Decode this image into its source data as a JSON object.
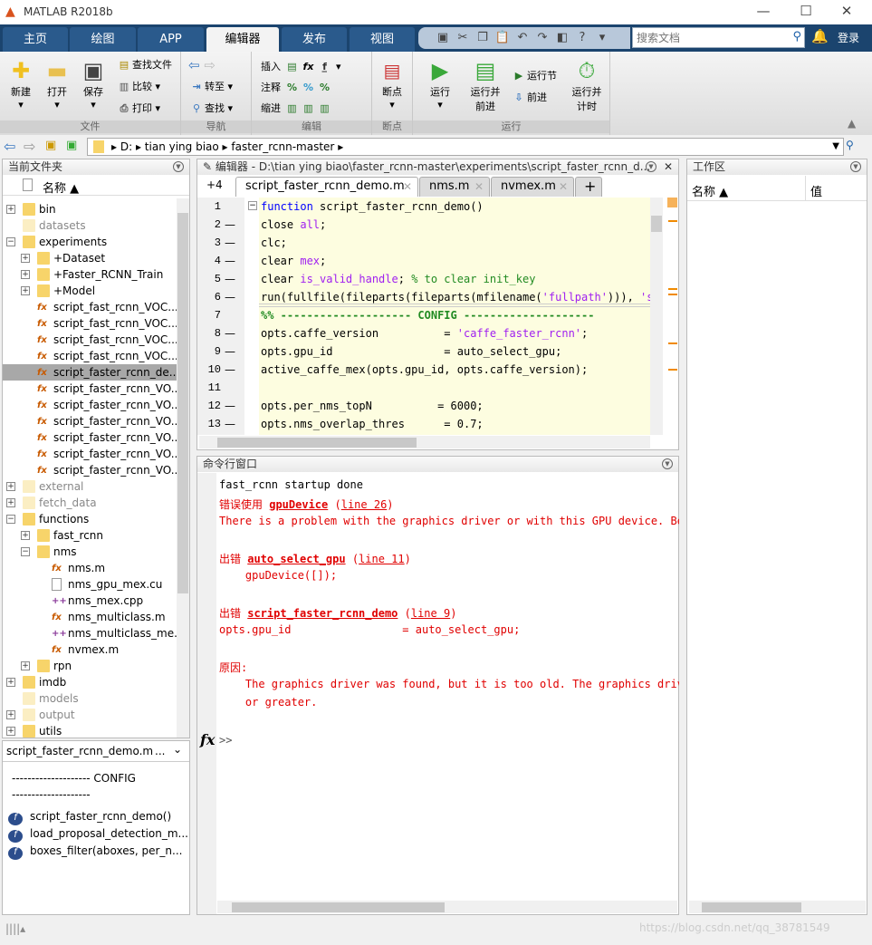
{
  "window": {
    "title": "MATLAB R2018b",
    "minimize": "—",
    "maximize": "☐",
    "close": "✕"
  },
  "tabs": [
    {
      "label": "主页"
    },
    {
      "label": "绘图"
    },
    {
      "label": "APP"
    },
    {
      "label": "编辑器",
      "active": true
    },
    {
      "label": "发布"
    },
    {
      "label": "视图"
    }
  ],
  "quick_access": [
    "save-icon",
    "cut-icon",
    "copy-icon",
    "paste-icon",
    "undo-icon",
    "redo-icon",
    "switch-windows-icon",
    "help-icon",
    "dropdown-icon"
  ],
  "search": {
    "placeholder": "搜索文档"
  },
  "login": "登录",
  "toolstrip": {
    "file": {
      "label": "文件",
      "new": "新建",
      "open": "打开",
      "save": "保存",
      "find_files": "查找文件",
      "compare": "比较",
      "print": "打印"
    },
    "navigate": {
      "label": "导航",
      "goto": "转至",
      "find": "查找"
    },
    "edit": {
      "label": "编辑",
      "insert": "插入",
      "comment": "注释",
      "indent": "缩进"
    },
    "breakpoints": {
      "label": "断点",
      "breakpoints": "断点"
    },
    "run": {
      "label": "运行",
      "run": "运行",
      "run_advance": "运行并\n前进",
      "run_section": "运行节",
      "advance": "前进",
      "run_time": "运行并\n计时"
    }
  },
  "address": {
    "path": [
      "D:",
      "tian ying biao",
      "faster_rcnn-master"
    ]
  },
  "current_folder": {
    "title": "当前文件夹",
    "col_name": "名称 ▲",
    "items": [
      {
        "name": "bin",
        "type": "folder",
        "level": 0,
        "expand": "+"
      },
      {
        "name": "datasets",
        "type": "folder",
        "level": 0,
        "dim": true
      },
      {
        "name": "experiments",
        "type": "folder",
        "level": 0,
        "expand": "-"
      },
      {
        "name": "+Dataset",
        "type": "folder",
        "level": 1,
        "expand": "+"
      },
      {
        "name": "+Faster_RCNN_Train",
        "type": "folder",
        "level": 1,
        "expand": "+"
      },
      {
        "name": "+Model",
        "type": "folder",
        "level": 1,
        "expand": "+"
      },
      {
        "name": "script_fast_rcnn_VOC...",
        "type": "m",
        "level": 1
      },
      {
        "name": "script_fast_rcnn_VOC...",
        "type": "m",
        "level": 1
      },
      {
        "name": "script_fast_rcnn_VOC...",
        "type": "m",
        "level": 1
      },
      {
        "name": "script_fast_rcnn_VOC...",
        "type": "m",
        "level": 1
      },
      {
        "name": "script_faster_rcnn_de...",
        "type": "m",
        "level": 1,
        "selected": true
      },
      {
        "name": "script_faster_rcnn_VO...",
        "type": "m",
        "level": 1
      },
      {
        "name": "script_faster_rcnn_VO...",
        "type": "m",
        "level": 1
      },
      {
        "name": "script_faster_rcnn_VO...",
        "type": "m",
        "level": 1
      },
      {
        "name": "script_faster_rcnn_VO...",
        "type": "m",
        "level": 1
      },
      {
        "name": "script_faster_rcnn_VO...",
        "type": "m",
        "level": 1
      },
      {
        "name": "script_faster_rcnn_VO...",
        "type": "m",
        "level": 1
      },
      {
        "name": "external",
        "type": "folder",
        "level": 0,
        "expand": "+",
        "dim": true
      },
      {
        "name": "fetch_data",
        "type": "folder",
        "level": 0,
        "expand": "+",
        "dim": true
      },
      {
        "name": "functions",
        "type": "folder",
        "level": 0,
        "expand": "-"
      },
      {
        "name": "fast_rcnn",
        "type": "folder",
        "level": 1,
        "expand": "+"
      },
      {
        "name": "nms",
        "type": "folder",
        "level": 1,
        "expand": "-"
      },
      {
        "name": "nms.m",
        "type": "m",
        "level": 2
      },
      {
        "name": "nms_gpu_mex.cu",
        "type": "file",
        "level": 2
      },
      {
        "name": "nms_mex.cpp",
        "type": "cpp",
        "level": 2
      },
      {
        "name": "nms_multiclass.m",
        "type": "m",
        "level": 2
      },
      {
        "name": "nms_multiclass_me...",
        "type": "cpp",
        "level": 2
      },
      {
        "name": "nvmex.m",
        "type": "m",
        "level": 2
      },
      {
        "name": "rpn",
        "type": "folder",
        "level": 1,
        "expand": "+"
      },
      {
        "name": "imdb",
        "type": "folder",
        "level": 0,
        "expand": "+"
      },
      {
        "name": "models",
        "type": "folder",
        "level": 0,
        "dim": true
      },
      {
        "name": "output",
        "type": "folder",
        "level": 0,
        "expand": "+",
        "dim": true
      },
      {
        "name": "utils",
        "type": "folder",
        "level": 0,
        "expand": "+"
      }
    ]
  },
  "details": {
    "file": "script_faster_rcnn_demo.m",
    "more": "...",
    "config_line1": "-------------------- CONFIG",
    "config_line2": "--------------------",
    "functions": [
      "script_faster_rcnn_demo()",
      "load_proposal_detection_m...",
      "boxes_filter(aboxes, per_n..."
    ]
  },
  "editor": {
    "title": "编辑器 - D:\\tian ying biao\\faster_rcnn-master\\experiments\\script_faster_rcnn_d...",
    "hidden_tabs": "+4",
    "tabs": [
      {
        "label": "script_faster_rcnn_demo.m",
        "active": true
      },
      {
        "label": "nms.m"
      },
      {
        "label": "nvmex.m"
      }
    ],
    "add_tab": "+",
    "lines": [
      {
        "n": "1",
        "bp": "",
        "tok": [
          [
            "function",
            "kw"
          ],
          [
            " script_faster_rcnn_demo()",
            ""
          ]
        ]
      },
      {
        "n": "2",
        "bp": "—",
        "tok": [
          [
            "close ",
            ""
          ],
          [
            "all",
            "str"
          ],
          [
            ";",
            ""
          ]
        ]
      },
      {
        "n": "3",
        "bp": "—",
        "tok": [
          [
            "clc;",
            ""
          ]
        ]
      },
      {
        "n": "4",
        "bp": "—",
        "tok": [
          [
            "clear ",
            ""
          ],
          [
            "mex",
            "str"
          ],
          [
            ";",
            ""
          ]
        ]
      },
      {
        "n": "5",
        "bp": "—",
        "tok": [
          [
            "clear ",
            ""
          ],
          [
            "is_valid_handle",
            "str"
          ],
          [
            "; ",
            ""
          ],
          [
            "% to clear init_key",
            "cm"
          ]
        ]
      },
      {
        "n": "6",
        "bp": "—",
        "tok": [
          [
            "run(fullfile(fileparts(fileparts(mfilename(",
            ""
          ],
          [
            "'fullpath'",
            "str"
          ],
          [
            "))), ",
            ""
          ],
          [
            "'sta",
            "str"
          ]
        ]
      },
      {
        "n": "7",
        "bp": "",
        "tok": [
          [
            "%% -------------------- CONFIG --------------------",
            "cell"
          ]
        ]
      },
      {
        "n": "8",
        "bp": "—",
        "tok": [
          [
            "opts.caffe_version          = ",
            ""
          ],
          [
            "'caffe_faster_rcnn'",
            "str"
          ],
          [
            ";",
            ""
          ]
        ]
      },
      {
        "n": "9",
        "bp": "—",
        "tok": [
          [
            "opts.gpu_id                 = auto_select_gpu;",
            ""
          ]
        ]
      },
      {
        "n": "10",
        "bp": "—",
        "tok": [
          [
            "active_caffe_mex(opts.gpu_id, opts.caffe_version);",
            ""
          ]
        ]
      },
      {
        "n": "11",
        "bp": "",
        "tok": [
          [
            "",
            ""
          ]
        ]
      },
      {
        "n": "12",
        "bp": "—",
        "tok": [
          [
            "opts.per_nms_topN          = 6000;",
            ""
          ]
        ]
      },
      {
        "n": "13",
        "bp": "—",
        "tok": [
          [
            "opts.nms_overlap_thres      = 0.7;",
            ""
          ]
        ]
      }
    ]
  },
  "command_window": {
    "title": "命令行窗口",
    "lines": [
      [
        [
          "fast_rcnn startup done",
          ""
        ]
      ],
      [
        [
          "错误使用 ",
          "err"
        ],
        [
          "gpuDevice",
          "lnk"
        ],
        [
          " (",
          "err"
        ],
        [
          "line 26",
          "lnk2"
        ],
        [
          ")",
          "err"
        ]
      ],
      [
        [
          "There is a problem with the graphics driver or with this GPU device. Be s",
          "err"
        ]
      ],
      [
        [
          "",
          ""
        ]
      ],
      [
        [
          "出错 ",
          "err"
        ],
        [
          "auto_select_gpu",
          "lnk"
        ],
        [
          " (",
          "err"
        ],
        [
          "line 11",
          "lnk2"
        ],
        [
          ")",
          "err"
        ]
      ],
      [
        [
          "    gpuDevice([]);",
          "err"
        ]
      ],
      [
        [
          "",
          ""
        ]
      ],
      [
        [
          "出错 ",
          "err"
        ],
        [
          "script_faster_rcnn_demo",
          "lnk"
        ],
        [
          " (",
          "err"
        ],
        [
          "line 9",
          "lnk2"
        ],
        [
          ")",
          "err"
        ]
      ],
      [
        [
          "opts.gpu_id                 = auto_select_gpu;",
          "err"
        ]
      ],
      [
        [
          "",
          ""
        ]
      ],
      [
        [
          "原因:",
          "err"
        ]
      ],
      [
        [
          "    The graphics driver was found, but it is too old. The graphics driver",
          "err"
        ]
      ],
      [
        [
          "    or greater.",
          "err"
        ]
      ]
    ],
    "prompt": ">>",
    "fx": "fx"
  },
  "workspace": {
    "title": "工作区",
    "col_name": "名称 ▲",
    "col_value": "值"
  },
  "watermark": "https://blog.csdn.net/qq_38781549"
}
